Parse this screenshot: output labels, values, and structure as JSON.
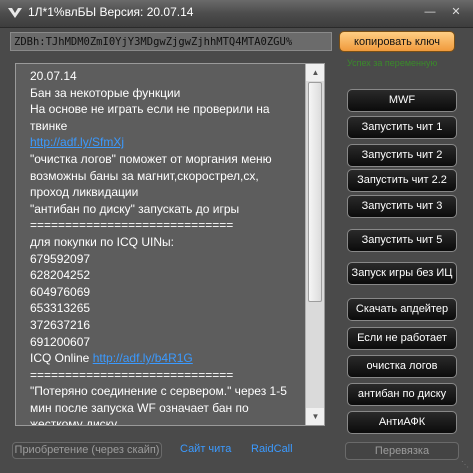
{
  "window": {
    "title": "1Л*1%влБЫ Версия: 20.07.14",
    "minimize_icon": "minimize-icon",
    "close_icon": "close-icon"
  },
  "key_field": {
    "value": "ZDBh:TJhMDM0ZmI0YjY3MDgwZjgwZjhhMTQ4MTA0ZGU%"
  },
  "copy_button": {
    "label": "копировать ключ"
  },
  "status": {
    "text": "Успех за переменную",
    "color": "#3a8a2a"
  },
  "notes": [
    {
      "text": "20.07.14"
    },
    {
      "text": "Бан за некоторые функции"
    },
    {
      "text": "На основе не играть если не проверили на"
    },
    {
      "text": "твинке"
    },
    {
      "text": "http://adf.ly/SfmXj",
      "link": true
    },
    {
      "text": "\"очистка логов\" поможет от моргания меню"
    },
    {
      "text": "возможны баны за магнит,скорострел,сх,"
    },
    {
      "text": "проход ликвидации"
    },
    {
      "text": "\"антибан по диску\" запускать до игры"
    },
    {
      "text": "============================="
    },
    {
      "text": "для покупки по ICQ UINы:"
    },
    {
      "text": "679592097"
    },
    {
      "text": "628204252"
    },
    {
      "text": "604976069"
    },
    {
      "text": "653313265"
    },
    {
      "text": "372637216"
    },
    {
      "text": "691200607"
    },
    {
      "prefix": "ICQ Online ",
      "text": "http://adf.ly/b4R1G",
      "link": true
    },
    {
      "text": "============================="
    },
    {
      "text": "\"Потеряно соединение с сервером.\" через 1-5"
    },
    {
      "text": "мин после запуска WF означает бан по"
    },
    {
      "text": "жесткому диску"
    }
  ],
  "side_buttons": [
    {
      "label": "MWF"
    },
    {
      "label": "Запустить чит 1"
    },
    {
      "label": "Запустить чит 2"
    },
    {
      "label": "Запустить чит 2.2"
    },
    {
      "label": "Запустить чит 3"
    },
    {
      "label": "Запустить чит 5"
    },
    {
      "label": "Запуск игры без ИЦ"
    },
    {
      "label": "Скачать апдейтер"
    },
    {
      "label": "Если не работает"
    },
    {
      "label": "очистка логов"
    },
    {
      "label": "антибан по диску"
    },
    {
      "label": "АнтиАФК"
    }
  ],
  "footer": {
    "purchase_label": "Приобретение (через скайп)",
    "site_label": "Сайт чита",
    "raidcall_label": "RaidCall",
    "transfer_label": "Перевязка"
  }
}
